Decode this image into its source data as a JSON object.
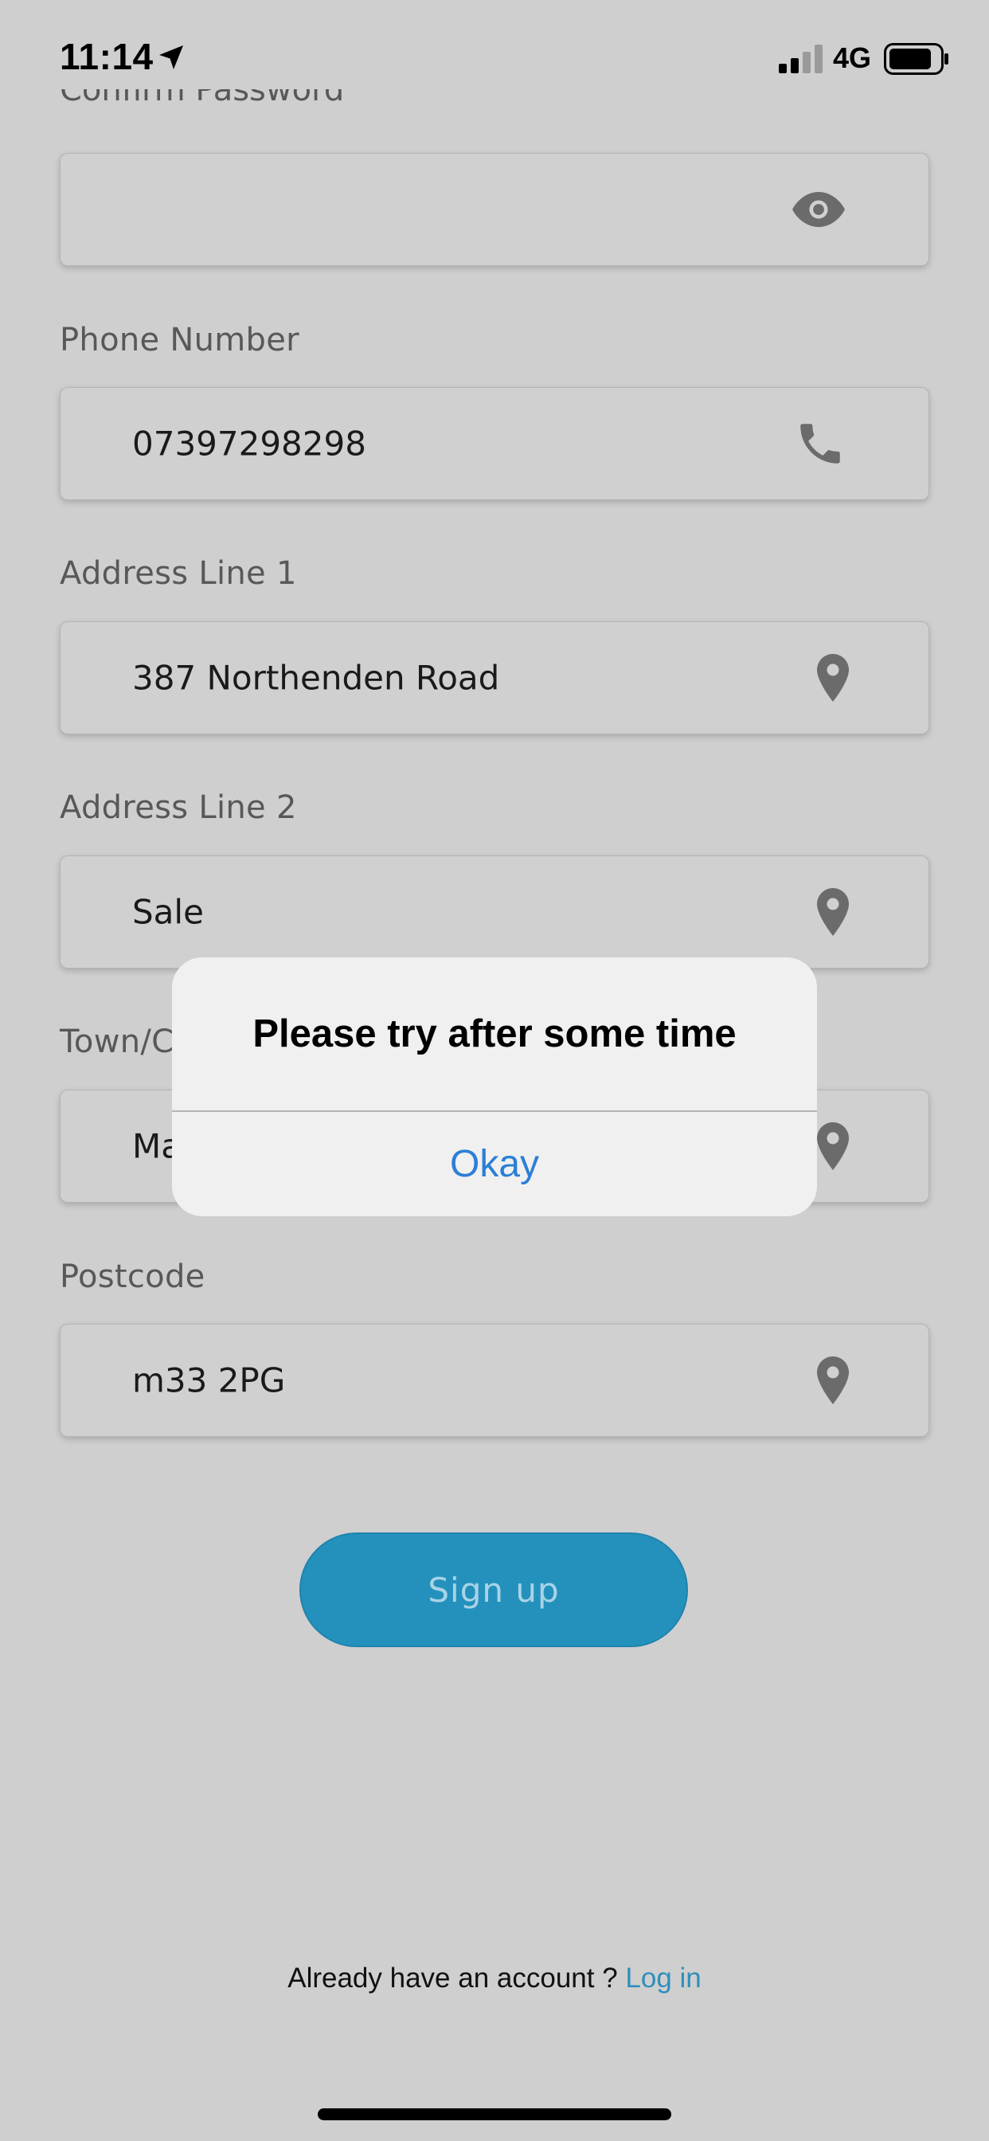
{
  "status_bar": {
    "time": "11:14",
    "network": "4G",
    "icons": [
      "location-arrow-icon",
      "signal-bars-icon",
      "battery-icon"
    ]
  },
  "form": {
    "confirm_password_label": "Confirm Password",
    "confirm_password_icon": "eye-icon",
    "fields": [
      {
        "label": "Phone Number",
        "value": "07397298298",
        "icon": "phone-icon"
      },
      {
        "label": "Address Line 1",
        "value": "387 Northenden Road",
        "icon": "map-pin-icon"
      },
      {
        "label": "Address Line 2",
        "value": "Sale",
        "icon": "map-pin-icon"
      },
      {
        "label": "Town/C",
        "value": "Ma",
        "icon": "map-pin-icon"
      },
      {
        "label": "Postcode",
        "value": "m33 2PG",
        "icon": "map-pin-icon"
      }
    ],
    "signup_label": "Sign up"
  },
  "footer": {
    "prompt": "Already have an account ? ",
    "login_label": "Log in"
  },
  "alert": {
    "title": "Please try after some time",
    "button_label": "Okay"
  },
  "colors": {
    "background": "#cfcfcf",
    "accent": "#2491bd",
    "link": "#2e8fbc",
    "alert_button": "#2b7fd6"
  }
}
